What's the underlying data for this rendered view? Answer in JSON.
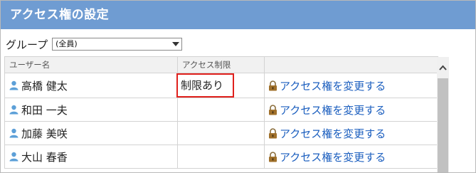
{
  "panel": {
    "title": "アクセス権の設定"
  },
  "group": {
    "label": "グループ",
    "selected": "(全員)"
  },
  "table": {
    "headers": {
      "name": "ユーザー名",
      "permission": "アクセス制限",
      "action": ""
    },
    "rows": [
      {
        "name": "高橋 健太",
        "permission": "制限あり",
        "action": "アクセス権を変更する"
      },
      {
        "name": "和田 一夫",
        "permission": "",
        "action": "アクセス権を変更する"
      },
      {
        "name": "加藤 美咲",
        "permission": "",
        "action": "アクセス権を変更する"
      },
      {
        "name": "大山 春香",
        "permission": "",
        "action": "アクセス権を変更する"
      }
    ]
  },
  "icons": {
    "user": "user-icon",
    "lock": "lock-icon",
    "chevron_up": "chevron-up-icon",
    "dropdown": "chevron-down-icon"
  },
  "colors": {
    "title_bar": "#6f9cd2",
    "link": "#1c5fbf",
    "highlight_border": "#e0201c"
  }
}
